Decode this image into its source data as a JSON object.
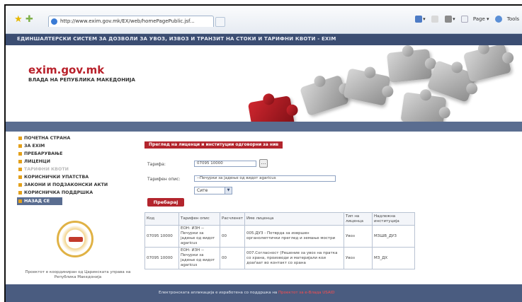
{
  "browser": {
    "url_tab": "http://www.exim.gov.mk/EX/web/homePagePublic.jsf...",
    "tools": [
      "Page",
      "Tools"
    ]
  },
  "site": {
    "banner": "ЕДИНШАЛТЕРСКИ СИСТЕМ ЗА ДОЗВОЛИ ЗА УВОЗ, ИЗВОЗ И ТРАНЗИТ НА СТОКИ И ТАРИФНИ КВОТИ - EXIM",
    "logo": "exim.gov.mk",
    "subtitle": "ВЛАДА НА РЕПУБЛИКА МАКЕДОНИЈА"
  },
  "nav": {
    "items": [
      {
        "label": "ПОЧЕТНА СТРАНА"
      },
      {
        "label": "ЗА EXIM"
      },
      {
        "label": "ПРЕБАРУВАЊЕ"
      },
      {
        "label": "ЛИЦЕНЦИ"
      },
      {
        "label": "ТАРИФНИ КВОТИ"
      },
      {
        "label": "КОРИСНИЧКИ УПАТСТВА"
      },
      {
        "label": "ЗАКОНИ И ПОДЗАКОНСКИ АКТИ"
      },
      {
        "label": "КОРИСНИЧКА ПОДДРШКА"
      },
      {
        "label": "НАЗАД СЕ"
      }
    ],
    "footer": "Проектот е координиран од Царинската управа на Република Македонија"
  },
  "content": {
    "heading": "Преглед на лиценци и институции одговорни за нив",
    "tariff_label": "Тарифа:",
    "tariff_value": "07095 10000",
    "desc_label": "Тарифен опис:",
    "desc_value": "--Печурки за јадење од видот agaricus",
    "select_value": "Сите",
    "search_button": "Пребарај",
    "table": {
      "headers": [
        "Код",
        "Тарифен опис",
        "Расчленет",
        "Име лиценца",
        "Тип на лиценца",
        "Надлежна институција"
      ],
      "rows": [
        [
          "07095 10000",
          "ЕОН: ИЗН -- Печурки за јадење од видот agaricus",
          "00",
          "005.ДУЗ - Потврда за извршен органолептички преглед и земање мостри",
          "Увоз",
          "МЗШВ_ДУЗ"
        ],
        [
          "07095 10000",
          "ЕОН: ИЗН -- Печурки за јадење од видот agaricus",
          "00",
          "007.Согласност (Решение за увоз на пратка со храна, производи и материјали кои доаѓаат во контакт со храна",
          "Увоз",
          "МЗ_ДХ"
        ]
      ]
    }
  },
  "footer": {
    "text": "Електронската апликација е изработена со поддршка на",
    "link": "Проектот за е-Влада",
    "link2": "USAID"
  }
}
